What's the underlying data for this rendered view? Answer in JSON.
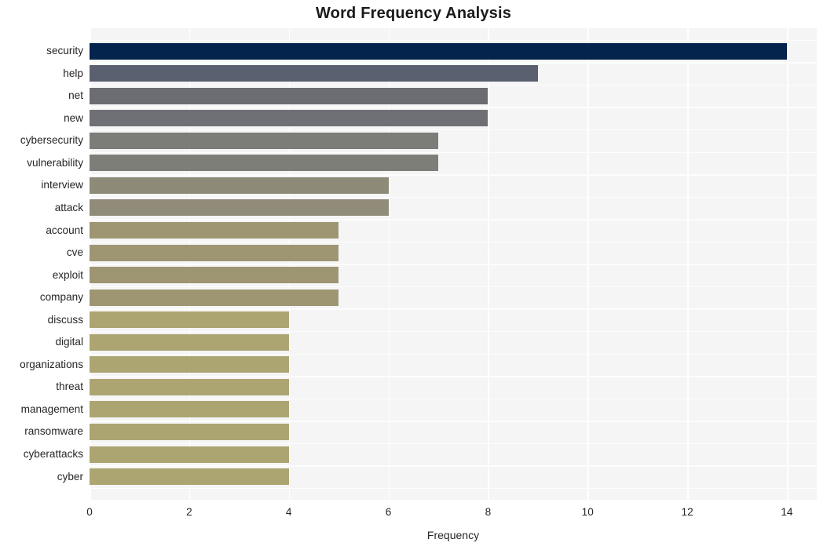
{
  "chart_data": {
    "type": "bar",
    "orientation": "horizontal",
    "title": "Word Frequency Analysis",
    "xlabel": "Frequency",
    "ylabel": "",
    "xlim": [
      0,
      14.6
    ],
    "ylim": [
      0,
      20
    ],
    "xticks": [
      0,
      2,
      4,
      6,
      8,
      10,
      12,
      14
    ],
    "xtick_labels": [
      "0",
      "2",
      "4",
      "6",
      "8",
      "10",
      "12",
      "14"
    ],
    "grid": true,
    "legend": false,
    "categories": [
      "security",
      "help",
      "net",
      "new",
      "cybersecurity",
      "vulnerability",
      "interview",
      "attack",
      "account",
      "cve",
      "exploit",
      "company",
      "discuss",
      "digital",
      "organizations",
      "threat",
      "management",
      "ransomware",
      "cyberattacks",
      "cyber"
    ],
    "values": [
      14,
      9,
      8,
      8,
      7,
      7,
      6,
      6,
      5,
      5,
      5,
      5,
      4,
      4,
      4,
      4,
      4,
      4,
      4,
      4
    ],
    "bar_colors": [
      "#04234d",
      "#5b6070",
      "#6b6d73",
      "#6e7076",
      "#7c7c78",
      "#7e7e79",
      "#8e8a78",
      "#908c79",
      "#9e9673",
      "#9e9673",
      "#9e9673",
      "#9e9673",
      "#ada571",
      "#ada571",
      "#ada571",
      "#ada571",
      "#ada571",
      "#ada571",
      "#ada571",
      "#ada571"
    ],
    "plot_background": "#f5f5f6",
    "gridline_color": "#ffffff",
    "figure_background": "#ffffff",
    "text_color": "#262626"
  }
}
